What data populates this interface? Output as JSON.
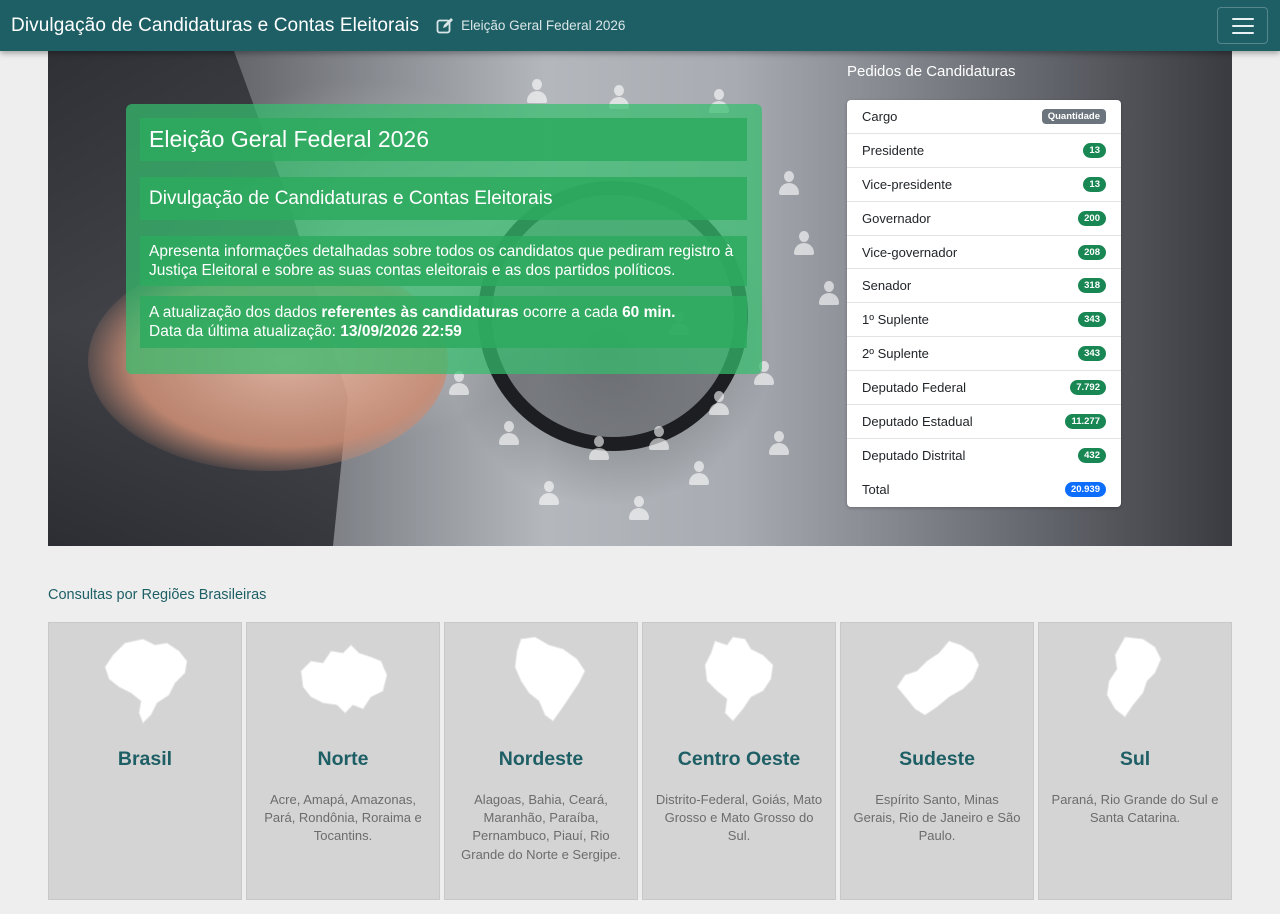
{
  "navbar": {
    "brand": "Divulgação de Candidaturas e Contas Eleitorais",
    "election": "Eleição Geral Federal 2026",
    "color": "#1e5f66"
  },
  "hero": {
    "title": "Eleição Geral Federal 2026",
    "subtitle": "Divulgação de Candidaturas e Contas Eleitorais",
    "description": "Apresenta informações detalhadas sobre todos os candidatos que pediram registro à Justiça Eleitoral e sobre as suas contas eleitorais e as dos partidos políticos.",
    "update_prefix": "A atualização dos dados ",
    "update_bold": "referentes às candidaturas",
    "update_mid": " ocorre a cada ",
    "update_interval": "60 min.",
    "last_update_label": "Data da última atualização: ",
    "last_update_value": "13/09/2026 22:59",
    "panel_color": "#34be6e"
  },
  "candidaturas": {
    "title": "Pedidos de Candidaturas",
    "header_label": "Cargo",
    "header_badge": "Quantidade",
    "rows": [
      {
        "label": "Presidente",
        "value": "13"
      },
      {
        "label": "Vice-presidente",
        "value": "13"
      },
      {
        "label": "Governador",
        "value": "200"
      },
      {
        "label": "Vice-governador",
        "value": "208"
      },
      {
        "label": "Senador",
        "value": "318"
      },
      {
        "label": "1º Suplente",
        "value": "343"
      },
      {
        "label": "2º Suplente",
        "value": "343"
      },
      {
        "label": "Deputado Federal",
        "value": "7.792"
      },
      {
        "label": "Deputado Estadual",
        "value": "11.277"
      },
      {
        "label": "Deputado Distrital",
        "value": "432"
      }
    ],
    "total_label": "Total",
    "total_value": "20.939",
    "badge_color": "#198754",
    "total_color": "#0d6efd"
  },
  "regions": {
    "title": "Consultas por Regiões Brasileiras",
    "items": [
      {
        "name": "Brasil",
        "desc": "",
        "icon": "brazil-map-icon"
      },
      {
        "name": "Norte",
        "desc": "Acre, Amapá, Amazonas, Pará, Rondônia, Roraima e Tocantins.",
        "icon": "norte-map-icon"
      },
      {
        "name": "Nordeste",
        "desc": "Alagoas, Bahia, Ceará, Maranhão, Paraíba, Pernambuco, Piauí, Rio Grande do Norte e Sergipe.",
        "icon": "nordeste-map-icon"
      },
      {
        "name": "Centro Oeste",
        "desc": "Distrito-Federal, Goiás, Mato Grosso e Mato Grosso do Sul.",
        "icon": "centro-oeste-map-icon"
      },
      {
        "name": "Sudeste",
        "desc": "Espírito Santo, Minas Gerais, Rio de Janeiro e São Paulo.",
        "icon": "sudeste-map-icon"
      },
      {
        "name": "Sul",
        "desc": "Paraná, Rio Grande do Sul e Santa Catarina.",
        "icon": "sul-map-icon"
      }
    ]
  }
}
